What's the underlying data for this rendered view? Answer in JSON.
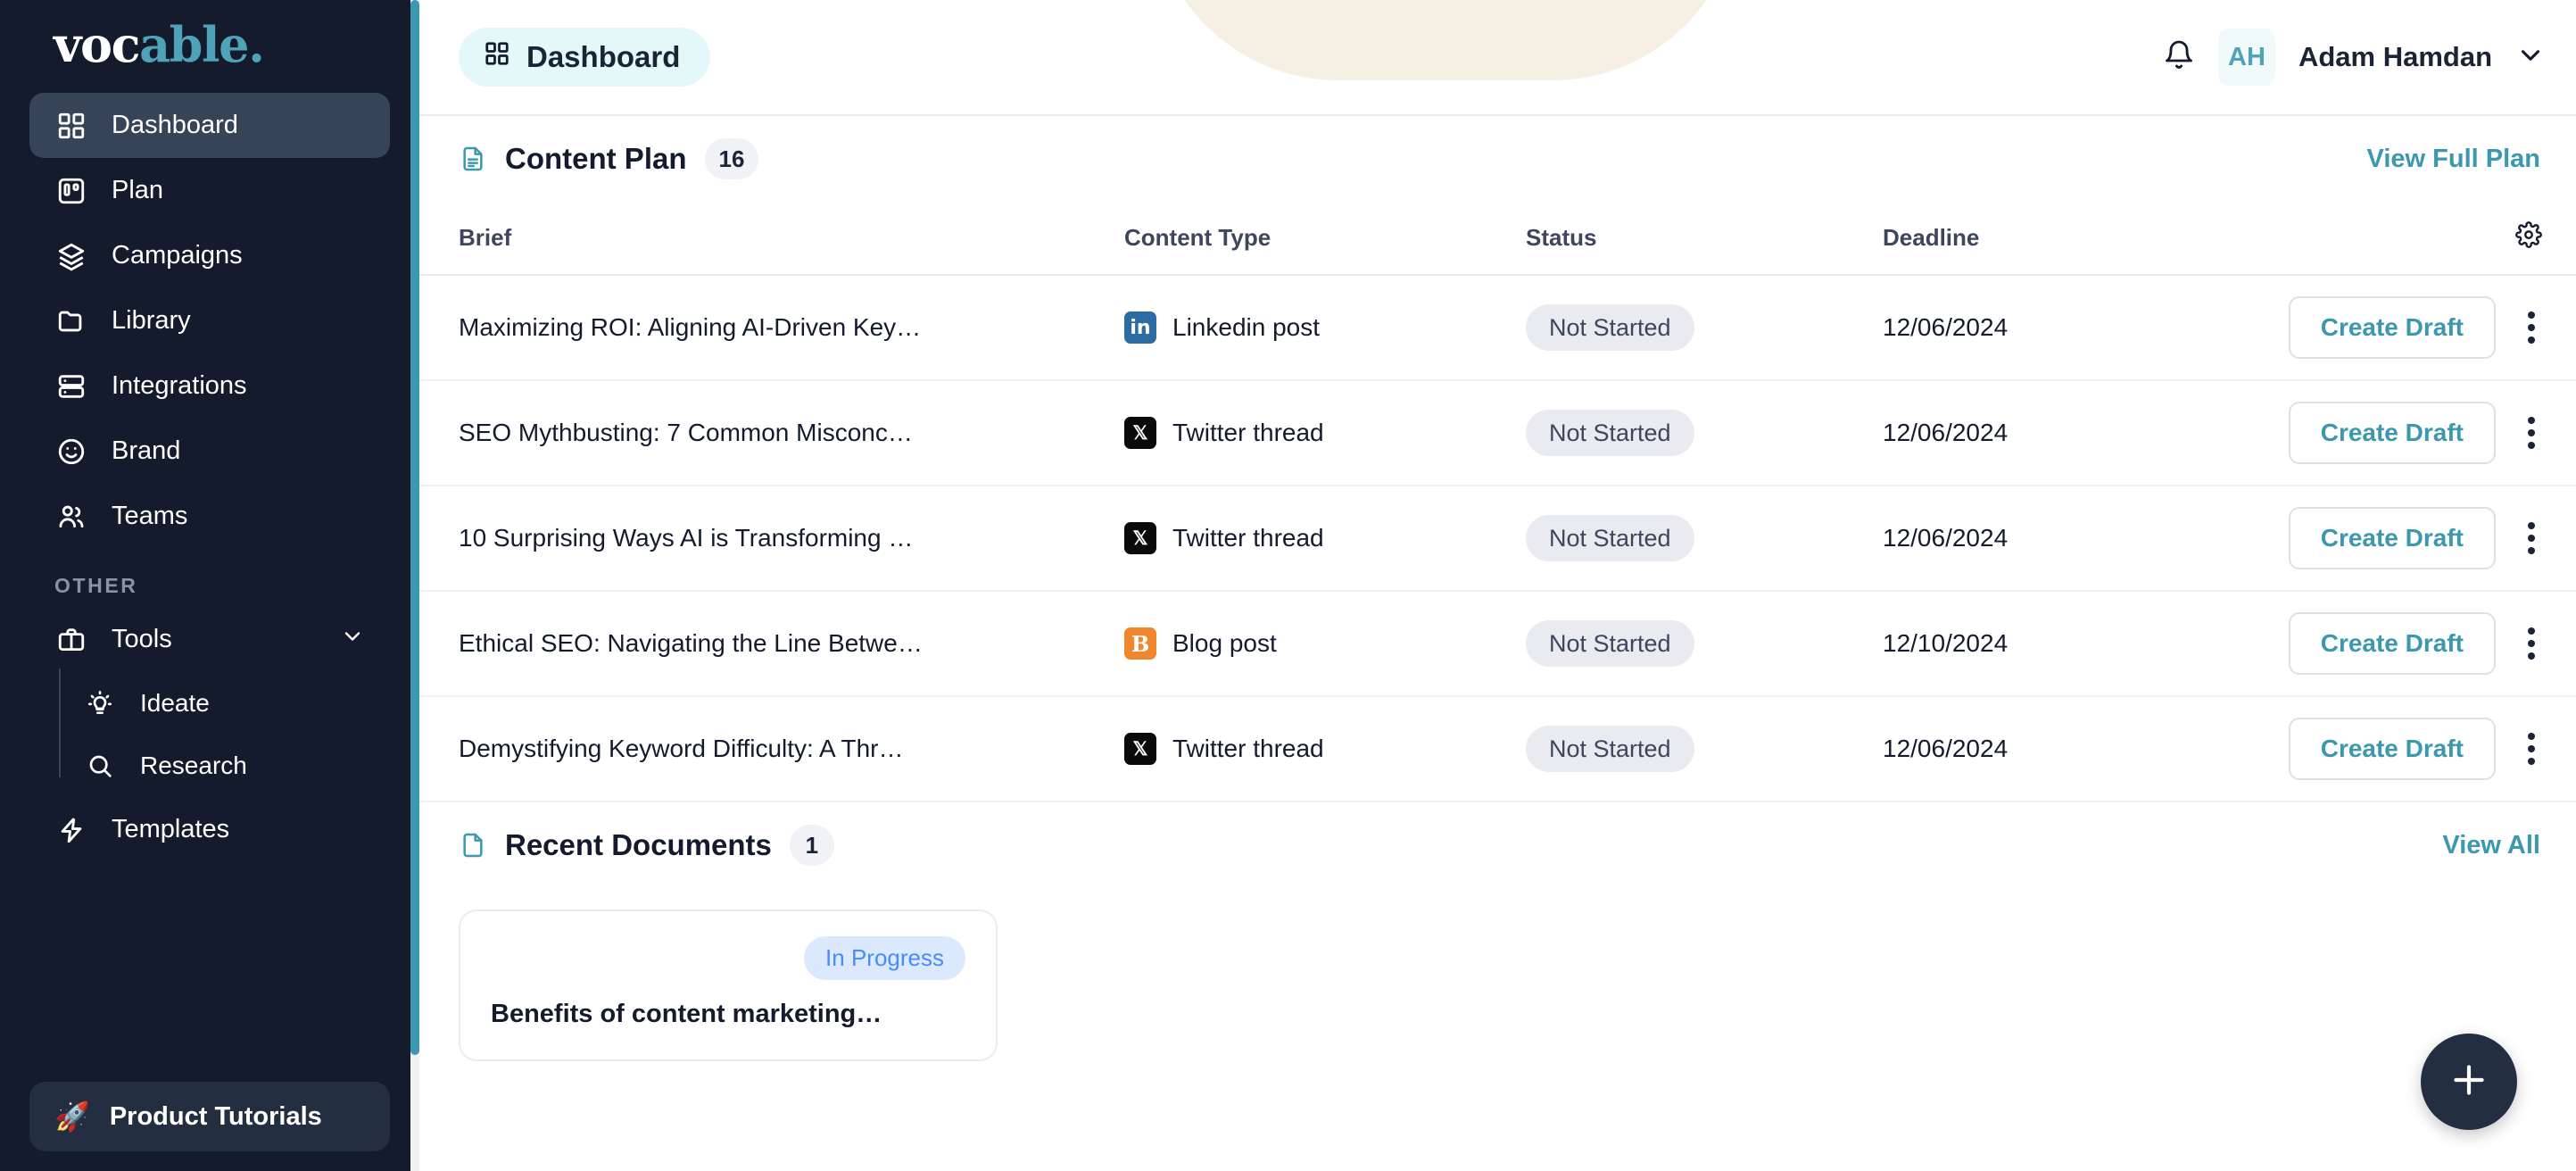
{
  "brand": {
    "name_white": "voc",
    "name_teal": "able.",
    "accent": "#3C98AE"
  },
  "sidebar": {
    "items": [
      {
        "label": "Dashboard",
        "icon": "grid-icon",
        "active": true
      },
      {
        "label": "Plan",
        "icon": "board-icon",
        "active": false
      },
      {
        "label": "Campaigns",
        "icon": "layers-icon",
        "active": false
      },
      {
        "label": "Library",
        "icon": "folder-icon",
        "active": false
      },
      {
        "label": "Integrations",
        "icon": "server-icon",
        "active": false
      },
      {
        "label": "Brand",
        "icon": "smiley-icon",
        "active": false
      },
      {
        "label": "Teams",
        "icon": "users-icon",
        "active": false
      }
    ],
    "section_label": "OTHER",
    "tools": {
      "label": "Tools",
      "icon": "briefcase-icon",
      "expanded": true
    },
    "tools_children": [
      {
        "label": "Ideate",
        "icon": "lightbulb-icon"
      },
      {
        "label": "Research",
        "icon": "search-icon"
      }
    ],
    "templates": {
      "label": "Templates",
      "icon": "bolt-icon"
    },
    "tutorials": {
      "label": "Product Tutorials",
      "icon": "rocket-icon"
    }
  },
  "topbar": {
    "page_title": "Dashboard",
    "page_icon": "grid-icon",
    "notifications_icon": "bell-icon",
    "avatar_initials": "AH",
    "user_name": "Adam Hamdan",
    "chevron_icon": "chevron-down-icon"
  },
  "content_plan": {
    "icon": "document-icon",
    "title": "Content Plan",
    "count": "16",
    "link_label": "View Full Plan",
    "settings_icon": "gear-icon",
    "columns": [
      "Brief",
      "Content Type",
      "Status",
      "Deadline"
    ],
    "action_label": "Create Draft",
    "rows": [
      {
        "brief": "Maximizing ROI: Aligning AI-Driven Key…",
        "type": "Linkedin post",
        "type_icon": "linkedin-icon",
        "status": "Not Started",
        "deadline": "12/06/2024"
      },
      {
        "brief": "SEO Mythbusting: 7 Common Misconc…",
        "type": "Twitter thread",
        "type_icon": "twitter-x-icon",
        "status": "Not Started",
        "deadline": "12/06/2024"
      },
      {
        "brief": "10 Surprising Ways AI is Transforming …",
        "type": "Twitter thread",
        "type_icon": "twitter-x-icon",
        "status": "Not Started",
        "deadline": "12/06/2024"
      },
      {
        "brief": "Ethical SEO: Navigating the Line Betwe…",
        "type": "Blog post",
        "type_icon": "blogger-icon",
        "status": "Not Started",
        "deadline": "12/10/2024"
      },
      {
        "brief": "Demystifying Keyword Difficulty: A Thr…",
        "type": "Twitter thread",
        "type_icon": "twitter-x-icon",
        "status": "Not Started",
        "deadline": "12/06/2024"
      }
    ]
  },
  "recent_documents": {
    "icon": "document-icon",
    "title": "Recent Documents",
    "count": "1",
    "link_label": "View All",
    "cards": [
      {
        "status": "In Progress",
        "title": "Benefits of content marketing…"
      }
    ]
  },
  "fab": {
    "icon": "plus-icon"
  }
}
